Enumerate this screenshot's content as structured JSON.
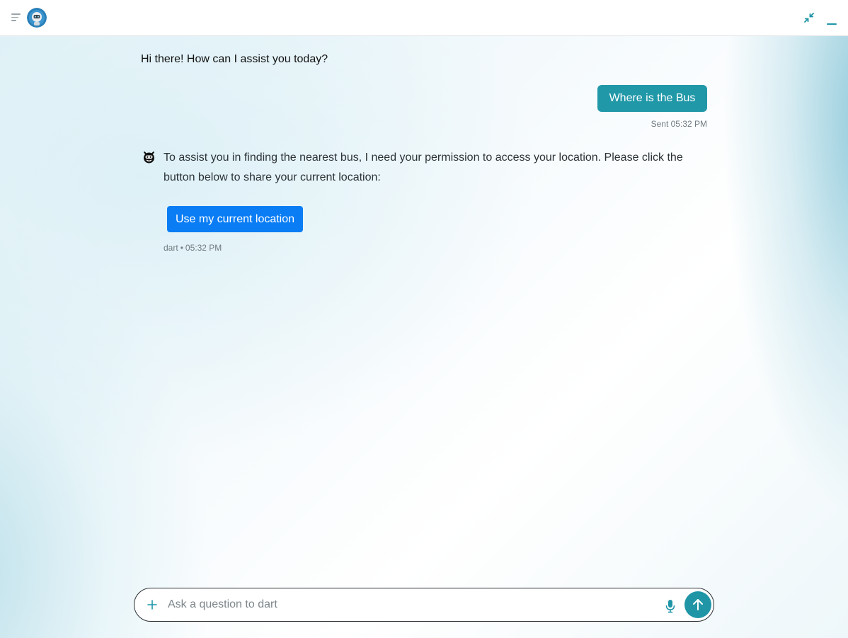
{
  "header": {
    "menu_icon": "menu-lines-icon",
    "avatar_icon": "robot-avatar-icon",
    "collapse_icon": "collapse-arrows-icon",
    "minimize_icon": "minimize-icon"
  },
  "conversation": {
    "greeting": "Hi there! How can I assist you today?",
    "user_message": "Where is the Bus",
    "user_sent_time": "Sent 05:32 PM",
    "bot_icon": "robot-face-icon",
    "bot_message": "To assist you in finding the nearest bus, I need your permission to access your location. Please click the button below to share your current location:",
    "location_button_label": "Use my current location",
    "bot_name": "dart",
    "bot_separator": "•",
    "bot_time": "05:32 PM"
  },
  "composer": {
    "placeholder": "Ask a question to dart",
    "value": "",
    "plus_icon": "plus-icon",
    "mic_icon": "microphone-icon",
    "send_icon": "arrow-up-icon"
  },
  "colors": {
    "accent": "#2198a8",
    "primary_button": "#0a7df5",
    "send_button": "#1f95a6"
  }
}
